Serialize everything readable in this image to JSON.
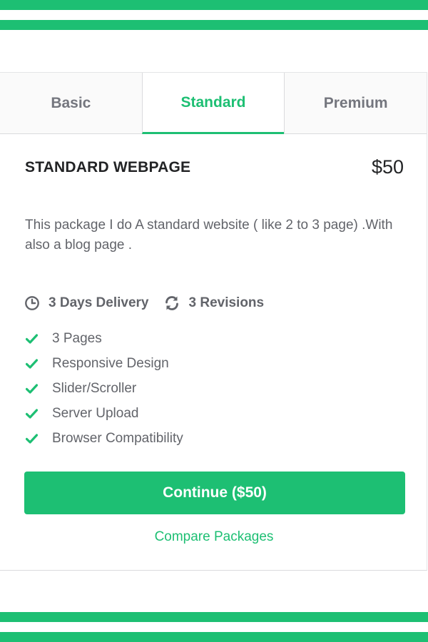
{
  "theme": {
    "accent": "#1dbf73",
    "text_dark": "#222325",
    "text_muted": "#62646a"
  },
  "tabs": [
    {
      "label": "Basic",
      "active": false
    },
    {
      "label": "Standard",
      "active": true
    },
    {
      "label": "Premium",
      "active": false
    }
  ],
  "package": {
    "title": "STANDARD WEBPAGE",
    "price": "$50",
    "description": "This package I do A standard website ( like 2 to 3 page) .With also a blog page .",
    "delivery": {
      "icon": "clock-icon",
      "label": "3 Days Delivery"
    },
    "revisions": {
      "icon": "refresh-icon",
      "label": "3 Revisions"
    },
    "features": [
      {
        "icon": "check-icon",
        "label": "3 Pages"
      },
      {
        "icon": "check-icon",
        "label": "Responsive Design"
      },
      {
        "icon": "check-icon",
        "label": "Slider/Scroller"
      },
      {
        "icon": "check-icon",
        "label": "Server Upload"
      },
      {
        "icon": "check-icon",
        "label": "Browser Compatibility"
      }
    ]
  },
  "actions": {
    "continue_label": "Continue ($50)",
    "compare_label": "Compare Packages"
  }
}
